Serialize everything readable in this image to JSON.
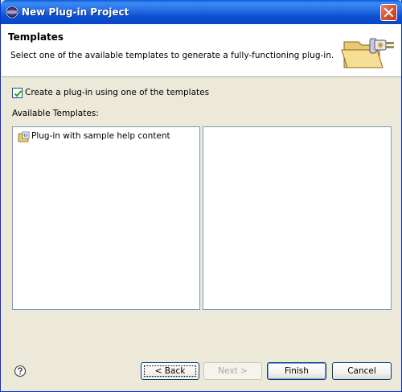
{
  "window": {
    "title": "New Plug-in Project"
  },
  "header": {
    "title": "Templates",
    "description": "Select one of the available templates to generate a fully-functioning plug-in."
  },
  "options": {
    "use_template_checked": true,
    "use_template_label": "Create a plug-in using one of the templates",
    "available_templates_label": "Available Templates:"
  },
  "templates": [
    {
      "label": "Plug-in with sample help content",
      "icon": "template-icon"
    }
  ],
  "description_panel": {
    "text": ""
  },
  "buttons": {
    "back": "< Back",
    "next": "Next >",
    "finish": "Finish",
    "cancel": "Cancel"
  },
  "colors": {
    "titlebar": "#0a4fd0",
    "dialog_bg": "#ece9d8",
    "close_button": "#d45333",
    "panel_border": "#7f9db9"
  }
}
